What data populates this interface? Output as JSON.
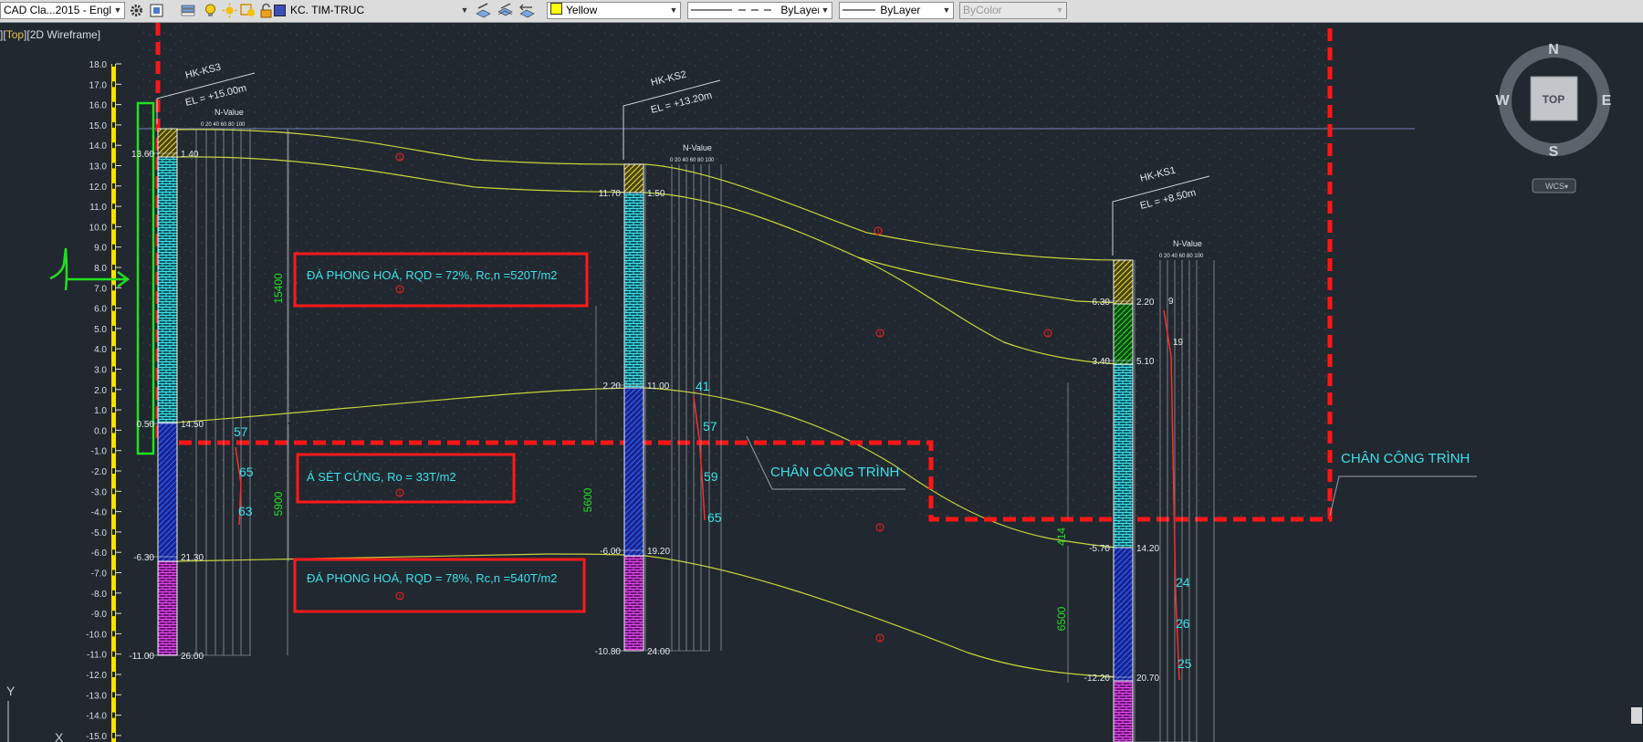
{
  "toolbar": {
    "workspace": "CAD Cla...2015 - Englisl",
    "layer": "KC. TIM-TRUC",
    "color": "Yellow",
    "linetype": "ByLayer",
    "lineweight": "ByLayer",
    "plotstyle": "ByColor"
  },
  "viewport": {
    "open": "]",
    "view": "Top",
    "style": "[2D Wireframe]"
  },
  "viewcube": {
    "n": "N",
    "s": "S",
    "e": "E",
    "w": "W",
    "top": "TOP",
    "wcs": "WCS"
  },
  "ucs": {
    "x": "X",
    "y": "Y"
  },
  "colors": {
    "yellow": "#d8de3a",
    "cyan": "#3fe0e8",
    "red": "#ff1a1a",
    "green": "#2ee02e",
    "magenta": "#d12fd6",
    "blue": "#2030d0"
  },
  "ruler_labels": [
    "18.0",
    "17.0",
    "16.0",
    "15.0",
    "14.0",
    "13.0",
    "12.0",
    "11.0",
    "10.0",
    "9.0",
    "8.0",
    "7.0",
    "6.0",
    "5.0",
    "4.0",
    "3.0",
    "2.0",
    "1.0",
    "0.0",
    "-1.0",
    "-2.0",
    "-3.0",
    "-4.0",
    "-5.0",
    "-6.0",
    "-7.0",
    "-8.0",
    "-9.0",
    "-10.0",
    "-11.0",
    "-12.0",
    "-13.0",
    "-14.0",
    "-15.0"
  ],
  "boreholes": [
    {
      "name": "HK-KS3",
      "el": "EL = +15.00m",
      "nvalue": "N-Value",
      "scale": "0  20 40 60 80 100",
      "depths": [
        {
          "l": "13.60",
          "r": "1.40"
        },
        {
          "l": "0.50",
          "r": "14.50"
        },
        {
          "l": "-6.30",
          "r": "21.30"
        },
        {
          "l": "-11.00",
          "r": "26.00"
        }
      ],
      "spt": [
        "57",
        "65",
        "63"
      ],
      "dim": [
        "15400",
        "5900"
      ]
    },
    {
      "name": "HK-KS2",
      "el": "EL = +13.20m",
      "nvalue": "N-Value",
      "scale": "0  20 40 60 80 100",
      "depths": [
        {
          "l": "11.70",
          "r": "1.50"
        },
        {
          "l": "2.20",
          "r": "11.00"
        },
        {
          "l": "-6.00",
          "r": "19.20"
        },
        {
          "l": "-10.80",
          "r": "24.00"
        }
      ],
      "spt": [
        "41",
        "57",
        "59",
        "65"
      ],
      "dim": [
        "5600"
      ]
    },
    {
      "name": "HK-KS1",
      "el": "EL = +8.50m",
      "nvalue": "N-Value",
      "scale": "0  20 40 60 80 100",
      "depths": [
        {
          "l": "6.30",
          "r": "2.20"
        },
        {
          "l": "3.40",
          "r": "5.10"
        },
        {
          "l": "-5.70",
          "r": "14.20"
        },
        {
          "l": "-12.20",
          "r": "20.70"
        }
      ],
      "spt_red": [
        "9",
        "19"
      ],
      "spt": [
        "24",
        "26",
        "25"
      ],
      "dim": [
        "414",
        "6500"
      ]
    }
  ],
  "layer_notes": [
    "ĐÁ PHONG HOÁ, RQD = 72%, Rc,n =520T/m2",
    "Á SÉT CỨNG, Ro = 33T/m2",
    "ĐÁ PHONG HOÁ, RQD = 78%, Rc,n =540T/m2"
  ],
  "callouts": [
    "CHÂN CÔNG TRÌNH",
    "CHÂN CÔNG TRÌNH"
  ],
  "markers": [
    "1",
    "1",
    "1",
    "1",
    "1",
    "1",
    "1",
    "1",
    "1"
  ]
}
